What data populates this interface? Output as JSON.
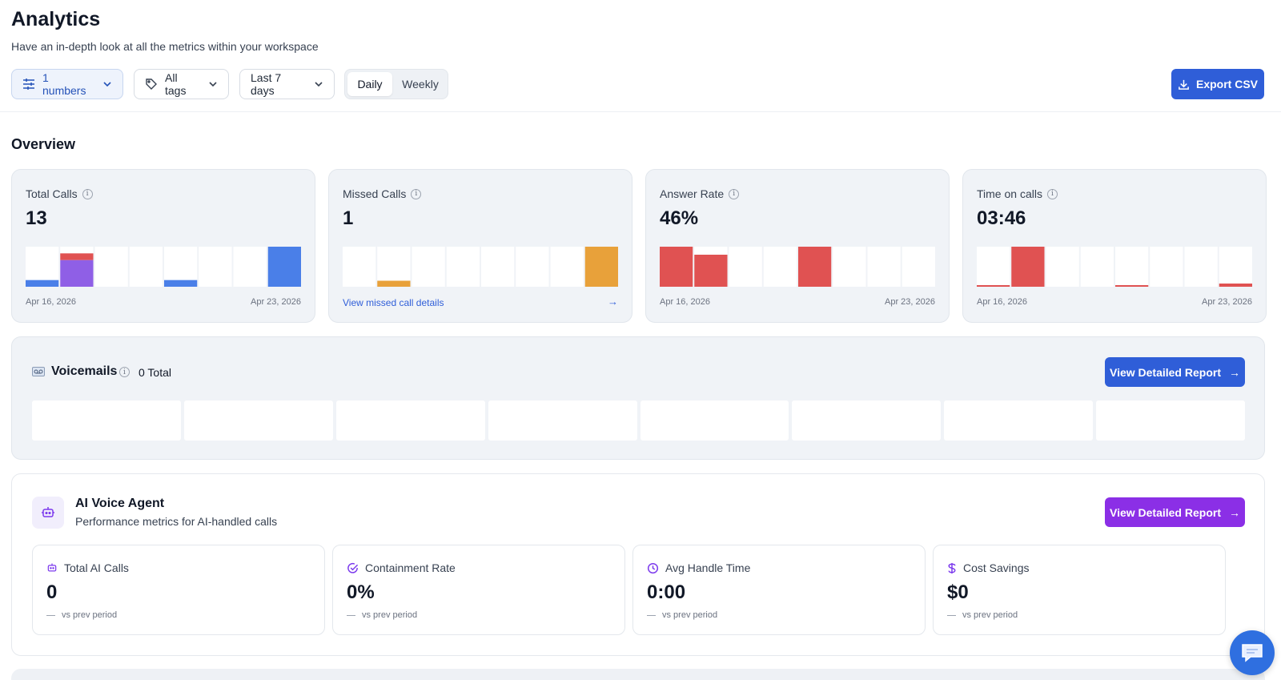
{
  "header": {
    "title": "Analytics",
    "subtitle": "Have an in-depth look at all the metrics within your workspace",
    "filters": {
      "numbers": "1 numbers",
      "tags": "All tags",
      "range": "Last 7 days"
    },
    "toggle": {
      "daily": "Daily",
      "weekly": "Weekly",
      "selected": "Daily"
    },
    "export_label": "Export CSV"
  },
  "overview": {
    "title": "Overview",
    "cards": [
      {
        "label": "Total Calls",
        "value": "13",
        "start": "Apr 16, 2026",
        "end": "Apr 23, 2026",
        "chart_data": {
          "type": "bar",
          "categories": [
            "1",
            "2",
            "3",
            "4",
            "5",
            "6",
            "7",
            "8"
          ],
          "series": [
            {
              "color": "#4a7fe8",
              "values": [
                1,
                0,
                0,
                0,
                1,
                0,
                0,
                6
              ]
            },
            {
              "color": "#8f5fe6",
              "values": [
                0,
                4,
                0,
                0,
                0,
                0,
                0,
                0
              ]
            },
            {
              "color": "#e05252",
              "values": [
                0,
                1,
                0,
                0,
                0,
                0,
                0,
                0
              ]
            }
          ],
          "ylim": [
            0,
            6
          ]
        }
      },
      {
        "label": "Missed Calls",
        "value": "1",
        "link": "View missed call details",
        "chart_data": {
          "type": "bar",
          "categories": [
            "1",
            "2",
            "3",
            "4",
            "5",
            "6",
            "7",
            "8"
          ],
          "series": [
            {
              "color": "#e8a13a",
              "values": [
                0,
                0.15,
                0,
                0,
                0,
                0,
                0,
                1
              ]
            }
          ],
          "ylim": [
            0,
            1
          ]
        }
      },
      {
        "label": "Answer Rate",
        "value": "46%",
        "start": "Apr 16, 2026",
        "end": "Apr 23, 2026",
        "chart_data": {
          "type": "bar",
          "categories": [
            "1",
            "2",
            "3",
            "4",
            "5",
            "6",
            "7",
            "8"
          ],
          "series": [
            {
              "color": "#e05252",
              "values": [
                100,
                80,
                0,
                0,
                100,
                0,
                0,
                0
              ]
            }
          ],
          "ylim": [
            0,
            100
          ]
        }
      },
      {
        "label": "Time on calls",
        "value": "03:46",
        "start": "Apr 16, 2026",
        "end": "Apr 23, 2026",
        "chart_data": {
          "type": "bar",
          "categories": [
            "1",
            "2",
            "3",
            "4",
            "5",
            "6",
            "7",
            "8"
          ],
          "series": [
            {
              "color": "#e05252",
              "values": [
                2,
                100,
                0,
                0,
                3,
                0,
                0,
                8
              ]
            }
          ],
          "ylim": [
            0,
            100
          ]
        }
      }
    ]
  },
  "voicemails": {
    "title": "Voicemails",
    "total": "0 Total",
    "button": "View Detailed Report"
  },
  "ai_agent": {
    "title": "AI Voice Agent",
    "subtitle": "Performance metrics for AI-handled calls",
    "button": "View Detailed Report",
    "metrics": [
      {
        "icon": "robot-icon",
        "label": "Total AI Calls",
        "value": "0",
        "compare": "vs prev period"
      },
      {
        "icon": "check-circle-icon",
        "label": "Containment Rate",
        "value": "0%",
        "compare": "vs prev period"
      },
      {
        "icon": "clock-icon",
        "label": "Avg Handle Time",
        "value": "0:00",
        "compare": "vs prev period"
      },
      {
        "icon": "dollar-icon",
        "label": "Cost Savings",
        "value": "$0",
        "compare": "vs prev period"
      }
    ]
  },
  "colors": {
    "accent_blue": "#2f5ed8",
    "accent_purple": "#8b2fe6",
    "card_bg": "#f0f3f7"
  }
}
